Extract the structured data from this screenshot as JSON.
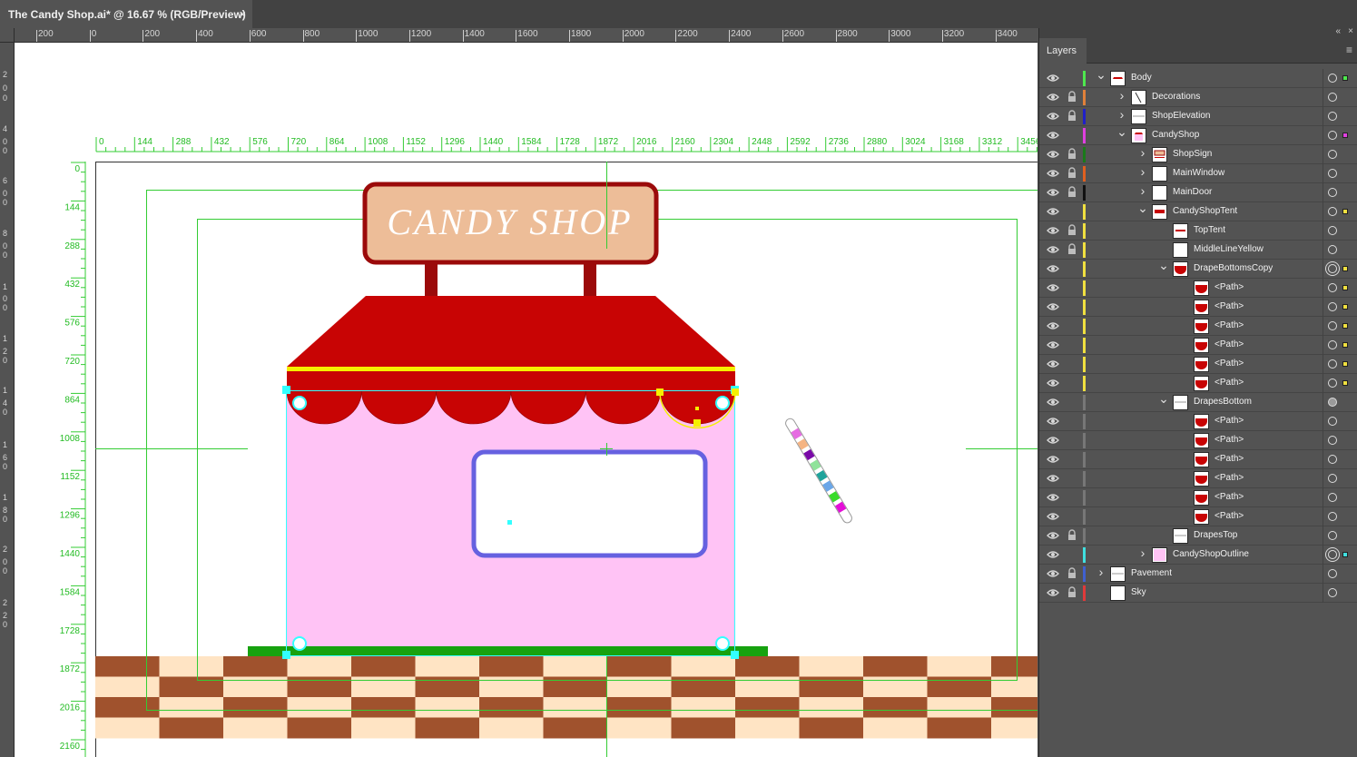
{
  "document_tab": {
    "title": "The Candy Shop.ai* @ 16.67 % (RGB/Preview)",
    "close": "×"
  },
  "top_ruler_labels": [
    "200",
    "0",
    "200",
    "400",
    "600",
    "800",
    "1000",
    "1200",
    "1400",
    "1600",
    "1800",
    "2000",
    "2200",
    "2400",
    "2600",
    "2800",
    "3000",
    "3200",
    "3400"
  ],
  "left_ruler_labels": [
    "2",
    "0",
    "0",
    "4",
    "0",
    "0",
    "6",
    "0",
    "0",
    "8",
    "0",
    "0",
    "1",
    "0",
    "0",
    "1",
    "2",
    "0",
    "1",
    "4",
    "0",
    "1",
    "6",
    "0",
    "1",
    "8",
    "0",
    "2",
    "0",
    "0",
    "2",
    "2",
    "0"
  ],
  "artboard_ruler_x": [
    "0",
    "144",
    "288",
    "432",
    "576",
    "720",
    "864",
    "1008",
    "1152",
    "1296",
    "1440",
    "1584",
    "1728",
    "1872",
    "2016",
    "2160",
    "2304",
    "2448",
    "2592",
    "2736",
    "2880",
    "3024",
    "3168",
    "3312",
    "3456"
  ],
  "artboard_ruler_y": [
    "0",
    "144",
    "288",
    "432",
    "576",
    "720",
    "864",
    "1008",
    "1152",
    "1296",
    "1440",
    "1584",
    "1728",
    "1872",
    "2016",
    "2160"
  ],
  "artwork": {
    "sign_text": "CANDY SHOP",
    "colors": {
      "sign_fill": "#edbd98",
      "sign_border": "#9b0a0a",
      "tent_red": "#c80404",
      "tent_stripe": "#f5f000",
      "shop_body": "#ffc3f5",
      "window_border": "#6661e0",
      "ground_green": "#17a20f",
      "tile_brown": "#a0522d",
      "tile_cream": "#ffe4c4",
      "guide_green": "#33cc33",
      "selection_cyan": "#33ffff"
    },
    "candy_stripe_colors": [
      "#e66ce2",
      "#f5b483",
      "#7a0aa8",
      "#8fe39a",
      "#1fa39b",
      "#6aa6e8",
      "#39db2a",
      "#e40ed8"
    ]
  },
  "panel": {
    "tab_label": "Layers",
    "collapse_icon": "«",
    "close_icon": "×",
    "menu_icon": "≡",
    "layers": [
      {
        "name": "Body",
        "depth": 0,
        "expanded": true,
        "locked": false,
        "color": "#4ee84e",
        "target": "single",
        "selected": true,
        "twirl": "down",
        "thumb": "body"
      },
      {
        "name": "Decorations",
        "depth": 1,
        "expanded": false,
        "locked": true,
        "color": "#e0813a",
        "target": "single",
        "selected": false,
        "twirl": "right",
        "thumb": "diag"
      },
      {
        "name": "ShopElevation",
        "depth": 1,
        "expanded": false,
        "locked": true,
        "color": "#2020c8",
        "target": "single",
        "selected": false,
        "twirl": "right",
        "thumb": "line"
      },
      {
        "name": "CandyShop",
        "depth": 1,
        "expanded": true,
        "locked": false,
        "color": "#e040e0",
        "target": "single",
        "selected": true,
        "twirl": "down",
        "thumb": "shop"
      },
      {
        "name": "ShopSign",
        "depth": 2,
        "expanded": false,
        "locked": true,
        "color": "#1a7a1a",
        "target": "single",
        "selected": false,
        "twirl": "right",
        "thumb": "sign"
      },
      {
        "name": "MainWindow",
        "depth": 2,
        "expanded": false,
        "locked": true,
        "color": "#e06020",
        "target": "single",
        "selected": false,
        "twirl": "right",
        "thumb": "blank"
      },
      {
        "name": "MainDoor",
        "depth": 2,
        "expanded": false,
        "locked": true,
        "color": "#111111",
        "target": "single",
        "selected": false,
        "twirl": "right",
        "thumb": "blank"
      },
      {
        "name": "CandyShopTent",
        "depth": 2,
        "expanded": true,
        "locked": false,
        "color": "#f0e040",
        "target": "single",
        "selected": true,
        "twirl": "down",
        "thumb": "tent"
      },
      {
        "name": "TopTent",
        "depth": 3,
        "expanded": false,
        "locked": true,
        "color": "#f0e040",
        "target": "single",
        "selected": false,
        "twirl": "",
        "thumb": "toptent"
      },
      {
        "name": "MiddleLineYellow",
        "depth": 3,
        "expanded": false,
        "locked": true,
        "color": "#f0e040",
        "target": "single",
        "selected": false,
        "twirl": "",
        "thumb": "blank"
      },
      {
        "name": "DrapeBottomsCopy",
        "depth": 3,
        "expanded": true,
        "locked": false,
        "color": "#f0e040",
        "target": "double",
        "selected": true,
        "twirl": "down",
        "thumb": "drape"
      },
      {
        "name": "<Path>",
        "depth": 4,
        "expanded": false,
        "locked": false,
        "color": "#f0e040",
        "target": "single",
        "selected": true,
        "twirl": "",
        "thumb": "drape"
      },
      {
        "name": "<Path>",
        "depth": 4,
        "expanded": false,
        "locked": false,
        "color": "#f0e040",
        "target": "single",
        "selected": true,
        "twirl": "",
        "thumb": "drape"
      },
      {
        "name": "<Path>",
        "depth": 4,
        "expanded": false,
        "locked": false,
        "color": "#f0e040",
        "target": "single",
        "selected": true,
        "twirl": "",
        "thumb": "drape"
      },
      {
        "name": "<Path>",
        "depth": 4,
        "expanded": false,
        "locked": false,
        "color": "#f0e040",
        "target": "single",
        "selected": true,
        "twirl": "",
        "thumb": "drape"
      },
      {
        "name": "<Path>",
        "depth": 4,
        "expanded": false,
        "locked": false,
        "color": "#f0e040",
        "target": "single",
        "selected": true,
        "twirl": "",
        "thumb": "drape"
      },
      {
        "name": "<Path>",
        "depth": 4,
        "expanded": false,
        "locked": false,
        "color": "#f0e040",
        "target": "single",
        "selected": true,
        "twirl": "",
        "thumb": "drape"
      },
      {
        "name": "DrapesBottom",
        "depth": 3,
        "expanded": true,
        "locked": false,
        "color": "#777777",
        "target": "filled",
        "selected": false,
        "twirl": "down",
        "thumb": "line"
      },
      {
        "name": "<Path>",
        "depth": 4,
        "expanded": false,
        "locked": false,
        "color": "#777777",
        "target": "single",
        "selected": false,
        "twirl": "",
        "thumb": "drape"
      },
      {
        "name": "<Path>",
        "depth": 4,
        "expanded": false,
        "locked": false,
        "color": "#777777",
        "target": "single",
        "selected": false,
        "twirl": "",
        "thumb": "drape"
      },
      {
        "name": "<Path>",
        "depth": 4,
        "expanded": false,
        "locked": false,
        "color": "#777777",
        "target": "single",
        "selected": false,
        "twirl": "",
        "thumb": "drape"
      },
      {
        "name": "<Path>",
        "depth": 4,
        "expanded": false,
        "locked": false,
        "color": "#777777",
        "target": "single",
        "selected": false,
        "twirl": "",
        "thumb": "drape"
      },
      {
        "name": "<Path>",
        "depth": 4,
        "expanded": false,
        "locked": false,
        "color": "#777777",
        "target": "single",
        "selected": false,
        "twirl": "",
        "thumb": "drape"
      },
      {
        "name": "<Path>",
        "depth": 4,
        "expanded": false,
        "locked": false,
        "color": "#777777",
        "target": "single",
        "selected": false,
        "twirl": "",
        "thumb": "drape"
      },
      {
        "name": "DrapesTop",
        "depth": 3,
        "expanded": false,
        "locked": true,
        "color": "#777777",
        "target": "single",
        "selected": false,
        "twirl": "",
        "thumb": "line"
      },
      {
        "name": "CandyShopOutline",
        "depth": 2,
        "expanded": false,
        "locked": false,
        "color": "#40e0e0",
        "target": "double",
        "selected": true,
        "twirl": "right",
        "thumb": "pink"
      },
      {
        "name": "Pavement",
        "depth": 0,
        "expanded": false,
        "locked": true,
        "color": "#4060d0",
        "target": "single",
        "selected": false,
        "twirl": "right",
        "thumb": "line"
      },
      {
        "name": "Sky",
        "depth": 0,
        "expanded": false,
        "locked": true,
        "color": "#e03a3a",
        "target": "single",
        "selected": false,
        "twirl": "",
        "thumb": "blank"
      }
    ]
  }
}
